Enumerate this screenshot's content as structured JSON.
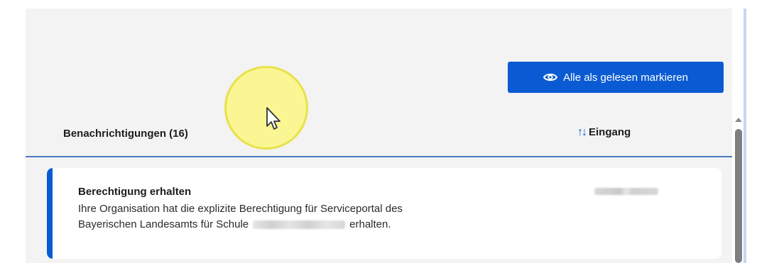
{
  "toolbar": {
    "mark_all_label": "Alle als gelesen markieren",
    "mark_all_icon": "eye-icon"
  },
  "list": {
    "header_title": "Benachrichtigungen (16)",
    "sort_label": "Eingang",
    "sort_icon": "sort-arrows-icon"
  },
  "notifications": [
    {
      "title": "Berechtigung erhalten",
      "body_line1": "Ihre Organisation hat die explizite Berechtigung für Serviceportal des",
      "body_line2_start": "Bayerischen Landesamts für Schule",
      "body_line2_end": "erhalten."
    }
  ],
  "colors": {
    "accent": "#0a5bd3",
    "panel_bg": "#f3f3f3",
    "divider": "#4a78c2",
    "cursor_highlight": "#faf682"
  }
}
